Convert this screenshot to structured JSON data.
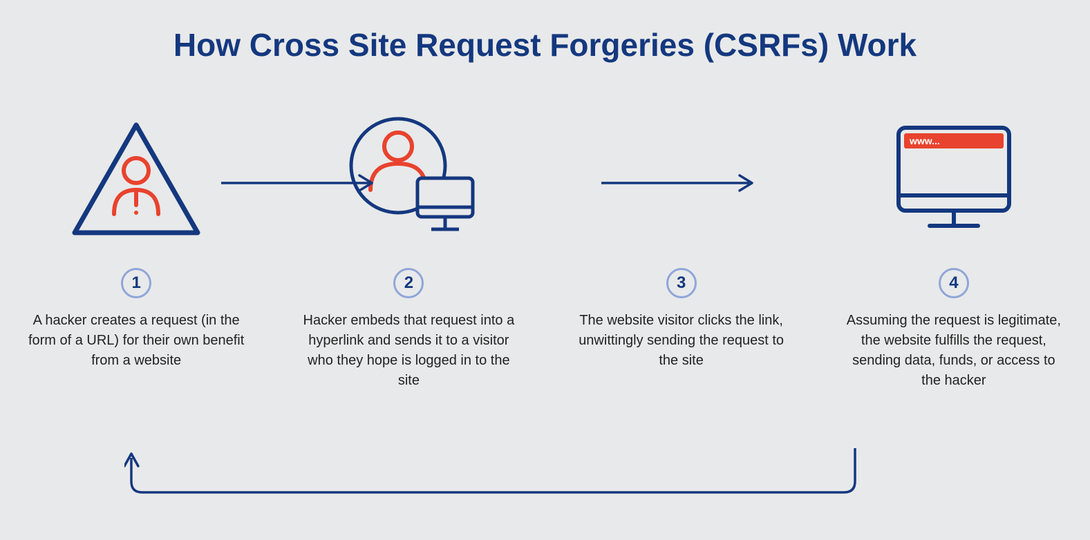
{
  "title": "How Cross Site Request Forgeries (CSRFs) Work",
  "colors": {
    "navy": "#14387f",
    "red": "#e8432e",
    "badge_blue": "#8fa6d9"
  },
  "steps": [
    {
      "num": "1",
      "desc": "A hacker creates a request (in the form of a URL) for their own benefit from a website",
      "icon": "hacker-warning"
    },
    {
      "num": "2",
      "desc": "Hacker embeds that request into a hyperlink and sends it to a visitor who they hope is logged in to the site",
      "icon": "user-computer"
    },
    {
      "num": "3",
      "desc": "The website visitor clicks the link, unwittingly sending the request to the site",
      "icon": ""
    },
    {
      "num": "4",
      "desc": "Assuming the request is legitimate, the website fulfills the request, sending data, funds, or access to the hacker",
      "icon": "malicious-site"
    }
  ],
  "browser_label": "www..."
}
